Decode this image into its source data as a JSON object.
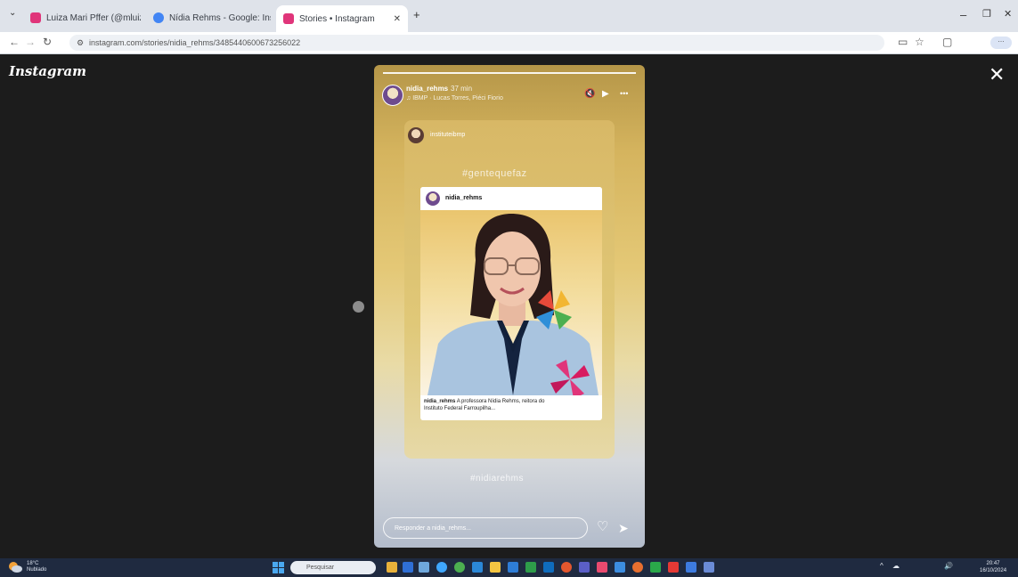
{
  "browser": {
    "tabs": [
      {
        "label": "Luiza Mari Pffer (@mluiza...",
        "favicon_color": "#e0357a",
        "active": false
      },
      {
        "label": "Nídia Rehms - Google: Instit...",
        "favicon_color": "#4285f4",
        "active": false
      },
      {
        "label": "Stories • Instagram",
        "favicon_color": "#e0357a",
        "active": true
      }
    ],
    "new_tab_label": "+",
    "url": "instagram.com/stories/nidia_rehms/3485440600673256022",
    "window_controls": {
      "minimize": "–",
      "maximize": "❐",
      "close": "✕"
    }
  },
  "instagram": {
    "logo": "Instagram",
    "close_label": "✕",
    "story": {
      "username": "nidia_rehms",
      "time": "37 min",
      "music": "♫ IBMP · Lucas Torres, Piéci Fiorio",
      "controls": {
        "mute": "🔇",
        "play": "▶",
        "more": "•••"
      },
      "repost": {
        "username": "instituteibmp",
        "hashtag_top": "#gentequefaz",
        "post": {
          "username": "nidia_rehms",
          "caption_user": "nidia_rehms",
          "caption_text": "A professora Nídia Rehms, reitora do Instituto Federal Farroupilha..."
        },
        "hashtag_bottom": "#nidiarehms"
      },
      "reply_placeholder": "Responder a nidia_rehms...",
      "heart_label": "♡",
      "send_label": "➤"
    }
  },
  "taskbar": {
    "weather": "18°C",
    "weather_desc": "Nublado",
    "search_placeholder": "Pesquisar",
    "clock_time": "20:47",
    "clock_date": "16/10/2024",
    "tray_icons": [
      "^",
      "☁",
      "🔊"
    ]
  },
  "colors": {
    "viewer_bg": "#1c1c1c",
    "taskbar_bg": "#1f2a40",
    "story_gold": "#d5b45e",
    "instagram_pink": "#e0357a"
  }
}
